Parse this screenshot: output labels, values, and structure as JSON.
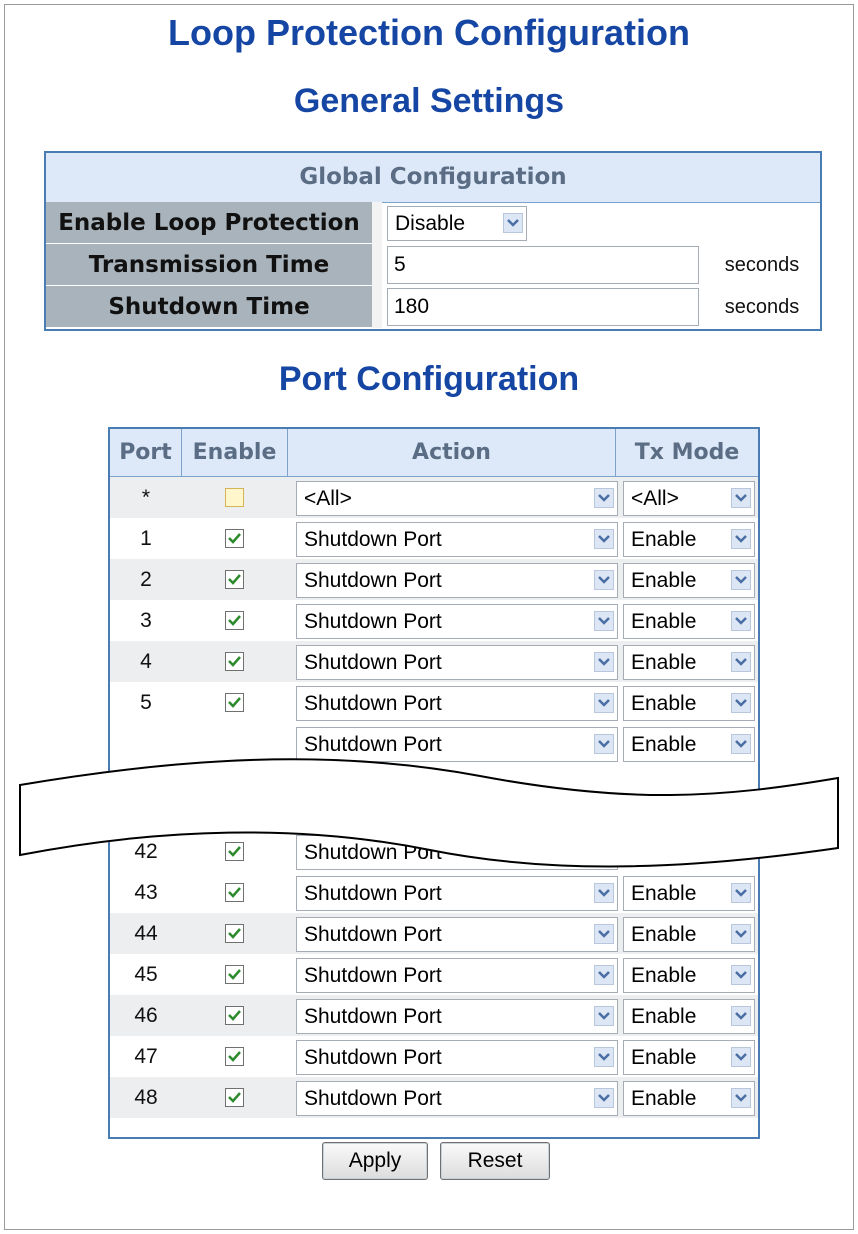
{
  "titles": {
    "main": "Loop Protection Configuration",
    "general": "General Settings",
    "port": "Port Configuration"
  },
  "global": {
    "header": "Global Configuration",
    "enable_label": "Enable Loop Protection",
    "enable_value": "Disable",
    "transmission_label": "Transmission Time",
    "transmission_value": "5",
    "transmission_unit": "seconds",
    "shutdown_label": "Shutdown Time",
    "shutdown_value": "180",
    "shutdown_unit": "seconds"
  },
  "port_table": {
    "headers": {
      "port": "Port",
      "enable": "Enable",
      "action": "Action",
      "tx_mode": "Tx Mode"
    },
    "all_row": {
      "port": "*",
      "enable": false,
      "action": "<All>",
      "tx_mode": "<All>"
    },
    "top_rows": [
      {
        "port": "1",
        "enable": true,
        "action": "Shutdown Port",
        "tx_mode": "Enable"
      },
      {
        "port": "2",
        "enable": true,
        "action": "Shutdown Port",
        "tx_mode": "Enable"
      },
      {
        "port": "3",
        "enable": true,
        "action": "Shutdown Port",
        "tx_mode": "Enable"
      },
      {
        "port": "4",
        "enable": true,
        "action": "Shutdown Port",
        "tx_mode": "Enable"
      },
      {
        "port": "5",
        "enable": true,
        "action": "Shutdown Port",
        "tx_mode": "Enable"
      }
    ],
    "partial_row": {
      "action": "Shutdown Port",
      "tx_mode": "Enable"
    },
    "partial_row_42": {
      "port": "42",
      "action": "Shutdown Port"
    },
    "bottom_rows": [
      {
        "port": "43",
        "enable": true,
        "action": "Shutdown Port",
        "tx_mode": "Enable"
      },
      {
        "port": "44",
        "enable": true,
        "action": "Shutdown Port",
        "tx_mode": "Enable"
      },
      {
        "port": "45",
        "enable": true,
        "action": "Shutdown Port",
        "tx_mode": "Enable"
      },
      {
        "port": "46",
        "enable": true,
        "action": "Shutdown Port",
        "tx_mode": "Enable"
      },
      {
        "port": "47",
        "enable": true,
        "action": "Shutdown Port",
        "tx_mode": "Enable"
      },
      {
        "port": "48",
        "enable": true,
        "action": "Shutdown Port",
        "tx_mode": "Enable"
      }
    ]
  },
  "buttons": {
    "apply": "Apply",
    "reset": "Reset"
  },
  "icons": {
    "dropdown": "chevron-down-icon",
    "checkbox": "checkmark-icon",
    "break": "wavy-break-icon"
  },
  "colors": {
    "title": "#1646a4",
    "border": "#4a7cb4",
    "header_bg": "#dde9f8",
    "label_bg": "#a9b3bb",
    "check": "#2d8a2d"
  }
}
